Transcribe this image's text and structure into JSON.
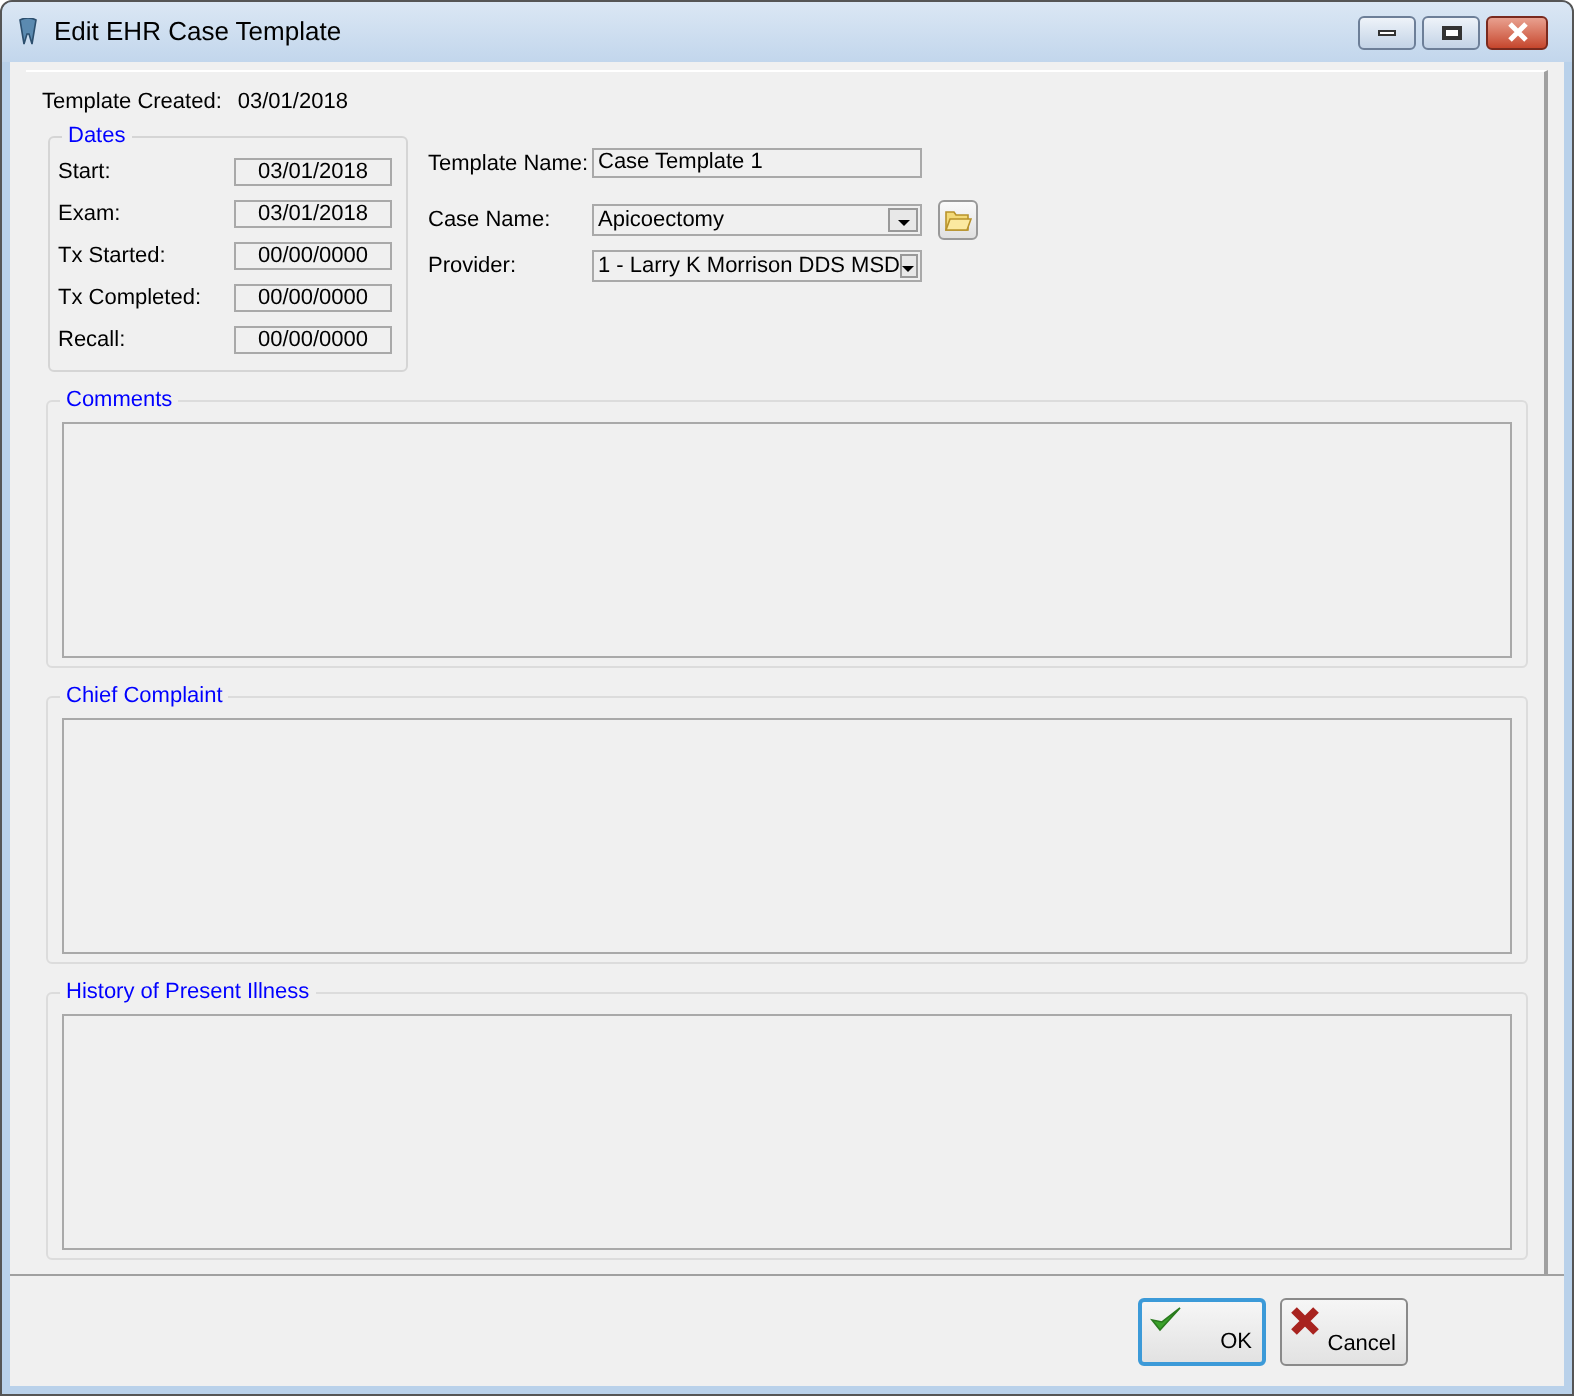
{
  "window": {
    "title": "Edit EHR Case Template"
  },
  "template_created": {
    "label": "Template Created:",
    "value": "03/01/2018"
  },
  "dates": {
    "title": "Dates",
    "fields": [
      {
        "label": "Start:",
        "value": "03/01/2018"
      },
      {
        "label": "Exam:",
        "value": "03/01/2018"
      },
      {
        "label": "Tx Started:",
        "value": "00/00/0000"
      },
      {
        "label": "Tx Completed:",
        "value": "00/00/0000"
      },
      {
        "label": "Recall:",
        "value": "00/00/0000"
      }
    ]
  },
  "template_name": {
    "label": "Template Name:",
    "value": "Case Template 1"
  },
  "case_name": {
    "label": "Case Name:",
    "value": "Apicoectomy"
  },
  "provider": {
    "label": "Provider:",
    "value": "1 - Larry K Morrison DDS MSD"
  },
  "sections": [
    {
      "title": "Comments"
    },
    {
      "title": "Chief Complaint"
    },
    {
      "title": "History of Present Illness"
    }
  ],
  "buttons": [
    {
      "kind": "ok",
      "label": "OK",
      "focused": true
    },
    {
      "kind": "cancel",
      "label": "Cancel",
      "focused": false
    }
  ]
}
